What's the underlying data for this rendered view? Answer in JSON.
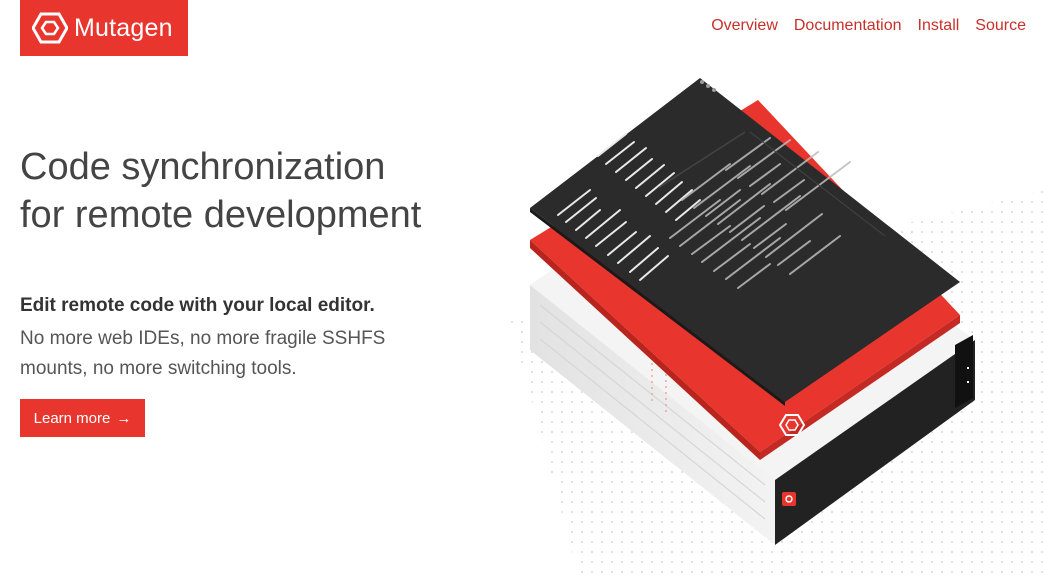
{
  "brand": {
    "name": "Mutagen",
    "color": "#e8362e",
    "link_color": "#c9302a"
  },
  "nav": {
    "items": [
      {
        "label": "Overview"
      },
      {
        "label": "Documentation"
      },
      {
        "label": "Install"
      },
      {
        "label": "Source"
      }
    ]
  },
  "hero": {
    "title": "Code synchronization for remote development",
    "lead": "Edit remote code with your local editor.",
    "description": "No more web IDEs, no more fragile SSHFS mounts, no more switching tools.",
    "cta_label": "Learn more",
    "cta_icon": "arrow-right-icon",
    "illustration": "layered-editor-sync-server-illustration"
  }
}
